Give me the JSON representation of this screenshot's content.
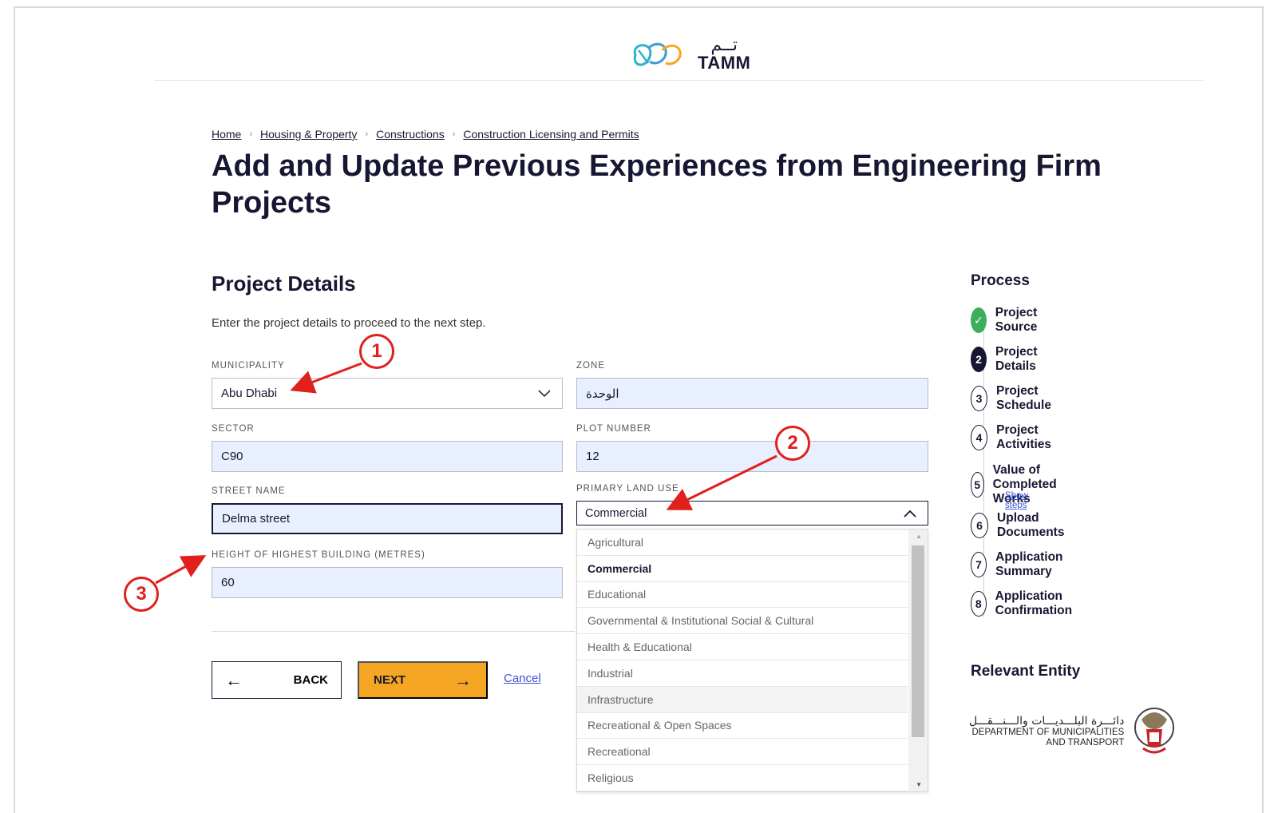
{
  "header": {
    "logo_ar": "تــم",
    "logo_en": "TAMM"
  },
  "breadcrumb": [
    {
      "label": "Home"
    },
    {
      "label": "Housing & Property"
    },
    {
      "label": "Constructions"
    },
    {
      "label": "Construction Licensing and Permits"
    }
  ],
  "page": {
    "title": "Add and Update Previous Experiences from Engineering Firm Projects",
    "section_title": "Project Details",
    "section_subtitle": "Enter the project details to proceed to the next step."
  },
  "form": {
    "municipality": {
      "label": "MUNICIPALITY",
      "value": "Abu Dhabi"
    },
    "zone": {
      "label": "ZONE",
      "value": "الوحدة"
    },
    "sector": {
      "label": "SECTOR",
      "value": "C90"
    },
    "plot_number": {
      "label": "PLOT NUMBER",
      "value": "12"
    },
    "street_name": {
      "label": "STREET NAME",
      "value": "Delma street"
    },
    "primary_land_use": {
      "label": "PRIMARY LAND USE",
      "value": "Commercial"
    },
    "height": {
      "label": "HEIGHT OF HIGHEST BUILDING (METRES)",
      "value": "60"
    }
  },
  "dropdown": {
    "options": [
      "Agricultural",
      "Commercial",
      "Educational",
      "Governmental & Institutional Social & Cultural",
      "Health & Educational",
      "Industrial",
      "Infrastructure",
      "Recreational & Open Spaces",
      "Recreational",
      "Religious"
    ],
    "selected_index": 1,
    "hover_index": 6
  },
  "actions": {
    "back_label": "BACK",
    "next_label": "NEXT",
    "cancel_label": "Cancel",
    "back_icon": "arrow-left-icon",
    "next_icon": "arrow-right-icon"
  },
  "process": {
    "title": "Process",
    "steps": [
      {
        "num": "✓",
        "label": "Project Source",
        "state": "done"
      },
      {
        "num": "2",
        "label": "Project Details",
        "state": "current"
      },
      {
        "num": "3",
        "label": "Project Schedule",
        "state": "todo"
      },
      {
        "num": "4",
        "label": "Project Activities",
        "state": "todo"
      },
      {
        "num": "5",
        "label": "Value of Completed Works",
        "state": "todo"
      },
      {
        "num": "6",
        "label": "Upload Documents",
        "state": "todo"
      },
      {
        "num": "7",
        "label": "Application Summary",
        "state": "todo"
      },
      {
        "num": "8",
        "label": "Application Confirmation",
        "state": "todo"
      }
    ],
    "show_steps": "Show steps"
  },
  "entity": {
    "title": "Relevant Entity",
    "name_ar": "دائـــرة البلـــديـــات والـــنـــقـــل",
    "name_en_1": "DEPARTMENT OF MUNICIPALITIES",
    "name_en_2": "AND TRANSPORT"
  },
  "annotations": {
    "marker_1": "1",
    "marker_2": "2",
    "marker_3": "3",
    "color": "#e0201b"
  },
  "colors": {
    "primary": "#181733",
    "accent": "#f5a623",
    "field_bg": "#e8efff",
    "success": "#3cae5c",
    "link": "#3d54d6"
  }
}
